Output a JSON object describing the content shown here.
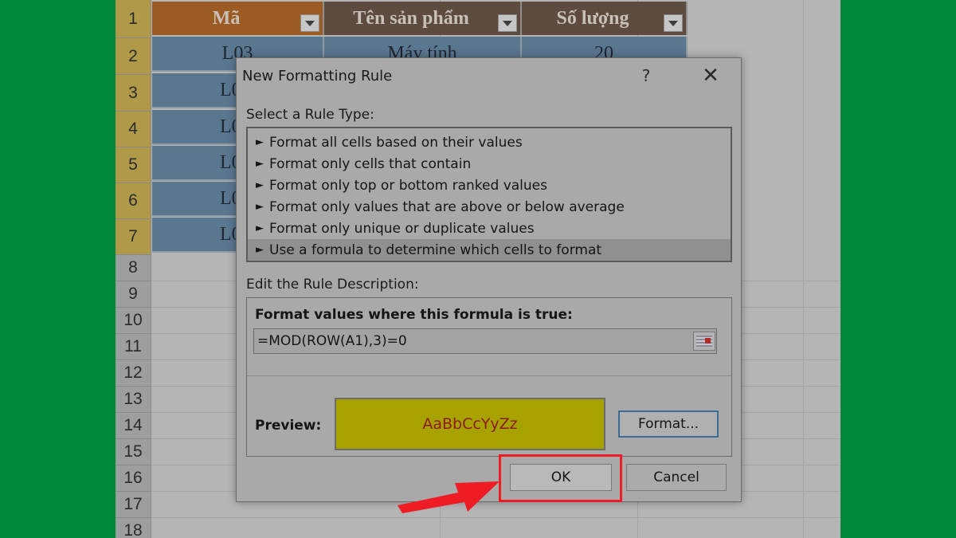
{
  "sheet": {
    "row_numbers": [
      "1",
      "2",
      "3",
      "4",
      "5",
      "6",
      "7",
      "8",
      "9",
      "10",
      "11",
      "12",
      "13",
      "14",
      "15",
      "16",
      "17",
      "18"
    ],
    "headers": [
      "Mã",
      "Tên sản phẩm",
      "Số lượng"
    ],
    "visible_cells": {
      "row2": [
        "L03",
        "Máy tính",
        "20"
      ],
      "col_a_partial": [
        "L0",
        "L0",
        "L0",
        "L0",
        "L0"
      ]
    }
  },
  "dialog": {
    "title": "New Formatting Rule",
    "help_label": "?",
    "close_label": "✕",
    "select_rule_label": "Select a Rule Type:",
    "rule_types": [
      "Format all cells based on their values",
      "Format only cells that contain",
      "Format only top or bottom ranked values",
      "Format only values that are above or below average",
      "Format only unique or duplicate values",
      "Use a formula to determine which cells to format"
    ],
    "selected_rule_index": 5,
    "edit_rule_label": "Edit the Rule Description:",
    "formula_heading": "Format values where this formula is true:",
    "formula_value": "=MOD(ROW(A1),3)=0",
    "preview_label": "Preview:",
    "preview_text": "AaBbCcYyZz",
    "format_button": "Format...",
    "ok_button": "OK",
    "cancel_button": "Cancel",
    "arrow_glyph": "►"
  },
  "colors": {
    "background_green": "#00883a",
    "highlight_red": "#ee1c24",
    "preview_fill": "#a8a200",
    "preview_text": "#8e1b12"
  },
  "icons": {
    "filter": "dropdown-arrow-icon",
    "collapse": "collapse-dialog-icon",
    "callout": "red-arrow-icon"
  }
}
